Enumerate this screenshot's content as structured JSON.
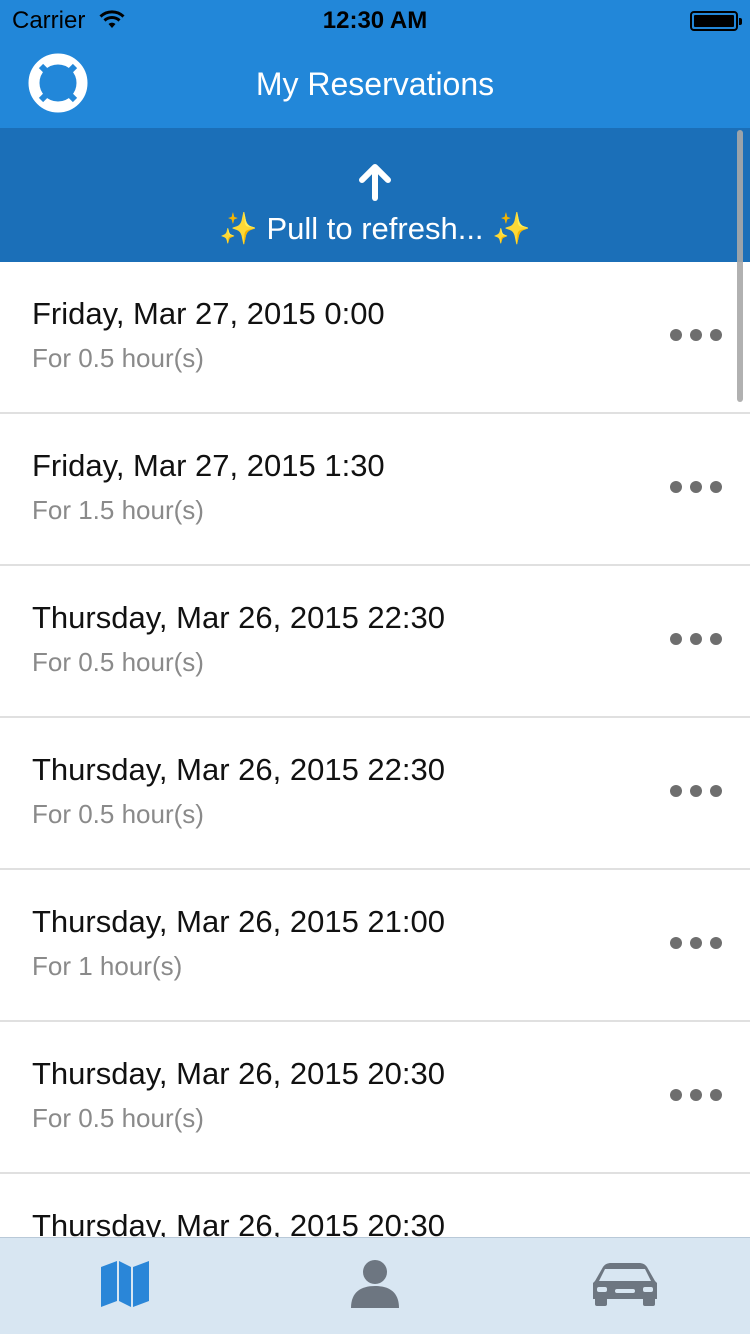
{
  "status_bar": {
    "carrier": "Carrier",
    "time": "12:30 AM"
  },
  "nav": {
    "title": "My Reservations",
    "left_icon": "lifebuoy-icon"
  },
  "refresh": {
    "text": "Pull to refresh...",
    "sparkle_left": "✨",
    "sparkle_right": "✨",
    "arrow_icon": "arrow-up-icon"
  },
  "reservations": [
    {
      "datetime": "Friday, Mar 27, 2015 0:00",
      "duration": "For 0.5 hour(s)"
    },
    {
      "datetime": "Friday, Mar 27, 2015 1:30",
      "duration": "For 1.5 hour(s)"
    },
    {
      "datetime": "Thursday, Mar 26, 2015 22:30",
      "duration": "For 0.5 hour(s)"
    },
    {
      "datetime": "Thursday, Mar 26, 2015 22:30",
      "duration": "For 0.5 hour(s)"
    },
    {
      "datetime": "Thursday, Mar 26, 2015 21:00",
      "duration": "For 1 hour(s)"
    },
    {
      "datetime": "Thursday, Mar 26, 2015 20:30",
      "duration": "For 0.5 hour(s)"
    },
    {
      "datetime": "Thursday, Mar 26, 2015 20:30",
      "duration": ""
    }
  ],
  "tabs": [
    {
      "icon": "map-icon",
      "active": true
    },
    {
      "icon": "person-icon",
      "active": false
    },
    {
      "icon": "car-icon",
      "active": false
    }
  ],
  "colors": {
    "nav_blue": "#2287d9",
    "refresh_blue": "#1b6fb8",
    "tab_active": "#2a86d8",
    "tab_inactive": "#6d7681"
  }
}
